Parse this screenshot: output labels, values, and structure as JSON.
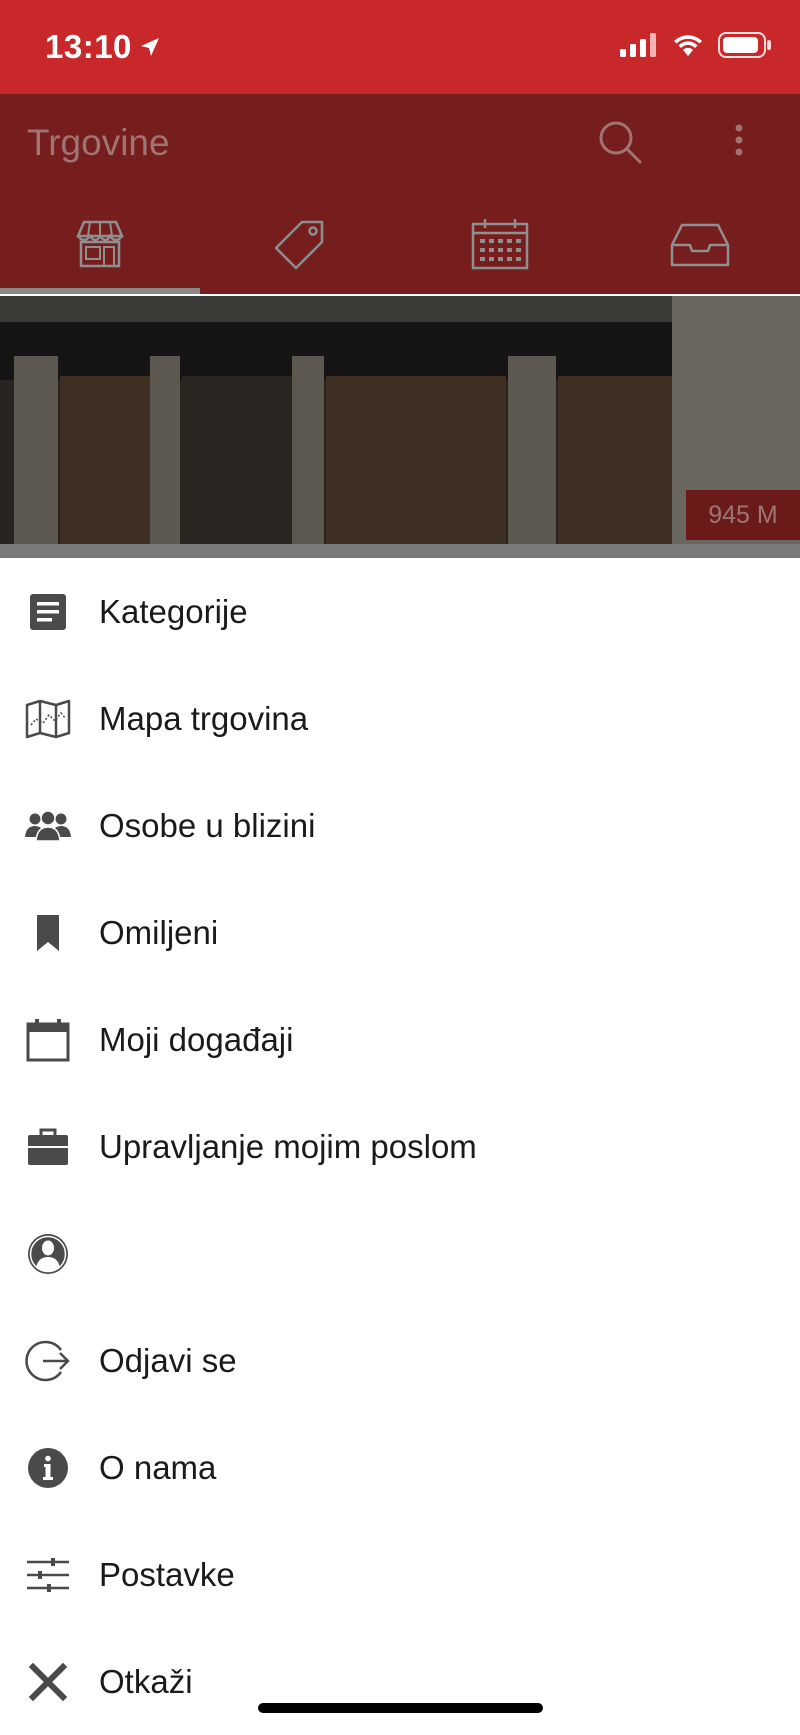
{
  "status_bar": {
    "time": "13:10",
    "icons": [
      "location-arrow-icon",
      "cellular-signal-icon",
      "wifi-icon",
      "battery-icon"
    ]
  },
  "app_bar": {
    "title": "Trgovine",
    "actions": [
      "search-icon",
      "more-vertical-icon"
    ],
    "tabs": [
      {
        "icon": "store-icon",
        "selected": true
      },
      {
        "icon": "tag-icon",
        "selected": false
      },
      {
        "icon": "calendar-icon",
        "selected": false
      },
      {
        "icon": "inbox-icon",
        "selected": false
      }
    ]
  },
  "store_card": {
    "distance": "945 M"
  },
  "menu": {
    "items": [
      {
        "label": "Kategorije",
        "icon": "document-icon"
      },
      {
        "label": "Mapa trgovina",
        "icon": "map-icon"
      },
      {
        "label": "Osobe u blizini",
        "icon": "people-icon"
      },
      {
        "label": "Omiljeni",
        "icon": "bookmark-icon"
      },
      {
        "label": "Moji događaji",
        "icon": "calendar-icon"
      },
      {
        "label": "Upravljanje mojim poslom",
        "icon": "briefcase-icon"
      },
      {
        "label": "",
        "icon": "user-avatar-icon"
      },
      {
        "label": "Odjavi se",
        "icon": "logout-icon"
      },
      {
        "label": "O nama",
        "icon": "info-icon"
      },
      {
        "label": "Postavke",
        "icon": "settings-sliders-icon"
      },
      {
        "label": "Otkaži",
        "icon": "close-icon"
      }
    ]
  },
  "colors": {
    "status_bar": "#c8282a",
    "app_bar_dimmed": "#761d1d",
    "menu_icon": "#4a4a4a",
    "menu_text": "#1a1a1a"
  }
}
